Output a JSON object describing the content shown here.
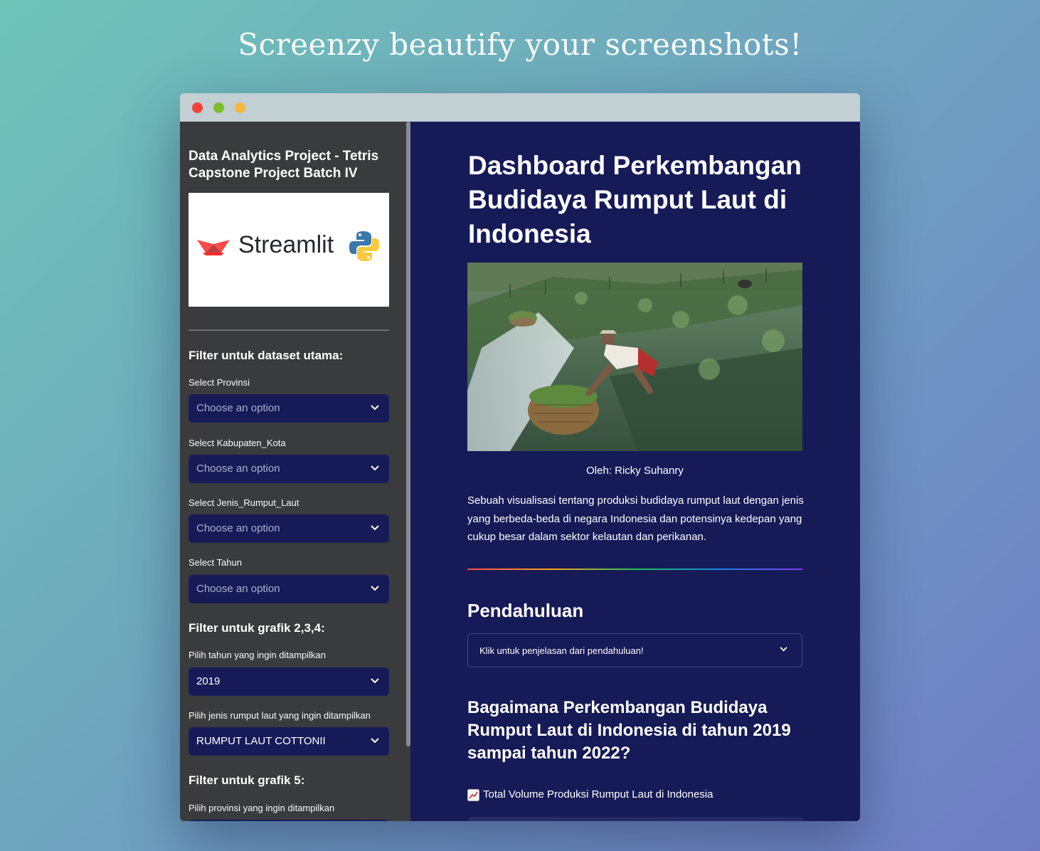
{
  "banner": {
    "text": "Screenzy beautify your screenshots!"
  },
  "sidebar": {
    "title": "Data Analytics Project - Tetris Capstone Project Batch IV",
    "logo": {
      "text": "Streamlit",
      "icons": [
        "streamlit-crown-icon",
        "python-icon"
      ]
    },
    "section_main": "Filter untuk dataset utama:",
    "filters_main": [
      {
        "label": "Select Provinsi",
        "placeholder": "Choose an option"
      },
      {
        "label": "Select Kabupaten_Kota",
        "placeholder": "Choose an option"
      },
      {
        "label": "Select Jenis_Rumput_Laut",
        "placeholder": "Choose an option"
      },
      {
        "label": "Select Tahun",
        "placeholder": "Choose an option"
      }
    ],
    "section_grafik": "Filter untuk grafik 2,3,4:",
    "filters_grafik": [
      {
        "label": "Pilih tahun yang ingin ditampilkan",
        "value": "2019"
      },
      {
        "label": "Pilih jenis rumput laut yang ingin ditampilkan",
        "value": "RUMPUT LAUT COTTONII"
      }
    ],
    "section_grafik5": "Filter untuk grafik 5:",
    "filter_grafik5_label": "Pilih provinsi yang ingin ditampilkan"
  },
  "main": {
    "title": "Dashboard Perkembangan Budidaya Rumput Laut di Indonesia",
    "caption": "Oleh: Ricky Suhanry",
    "description": "Sebuah visualisasi tentang produksi budidaya rumput laut dengan jenis yang berbeda-beda di negara Indonesia dan potensinya kedepan yang cukup besar dalam sektor kelautan dan perikanan.",
    "section_intro": "Pendahuluan",
    "expander_label": "Klik untuk penjelasan dari pendahuluan!",
    "question": "Bagaimana Perkembangan Budidaya Rumput Laut di Indonesia di tahun 2019 sampai tahun 2022?",
    "chart_label": "Total Volume Produksi Rumput Laut di Indonesia",
    "chart_icon": "chart-increasing-icon"
  },
  "colors": {
    "sidebar_bg": "#3a3b3d",
    "main_bg": "#161b57",
    "select_bg": "#161b57"
  }
}
